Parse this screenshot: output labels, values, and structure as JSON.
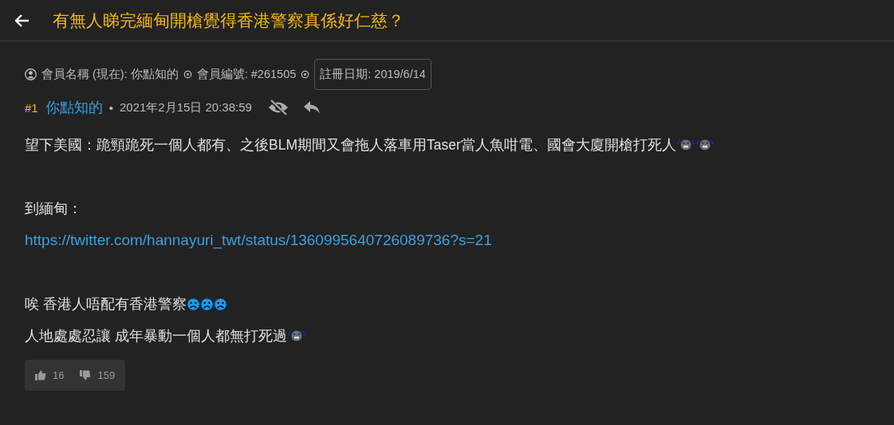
{
  "header": {
    "title": "有無人睇完緬甸開槍覺得香港警察真係好仁慈？"
  },
  "member": {
    "name_label": "會員名稱 (現在): 你點知的",
    "id_label": "會員編號: #261505",
    "registered": "註冊日期: 2019/6/14"
  },
  "post": {
    "number": "#1",
    "author": "你點知的",
    "separator": "•",
    "time": "2021年2月15日 20:38:59",
    "body": [
      {
        "kind": "text",
        "text": "望下美國：跪頸跪死一個人都有、之後BLM期間又會拖人落車用Taser當人魚咁電、國會大廈開槍打死人",
        "emoticons": [
          {
            "kind": "angry"
          },
          {
            "kind": "angry"
          }
        ]
      },
      {
        "kind": "blank"
      },
      {
        "kind": "text",
        "text": "到緬甸："
      },
      {
        "kind": "link",
        "text": "https://twitter.com/hannayuri_twt/status/1360995640726089736?s=21"
      },
      {
        "kind": "blank"
      },
      {
        "kind": "text",
        "text": "唉 香港人唔配有香港警察",
        "emoticons": [
          {
            "kind": "sad"
          },
          {
            "kind": "sad"
          },
          {
            "kind": "sad"
          }
        ]
      },
      {
        "kind": "text",
        "text": "人地處處忍讓 成年暴動一個人都無打死過",
        "emoticons": [
          {
            "kind": "angry"
          }
        ]
      }
    ],
    "likes": "16",
    "dislikes": "159"
  }
}
